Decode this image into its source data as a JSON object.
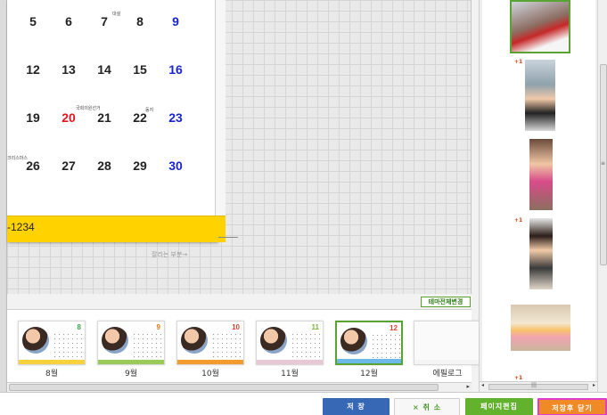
{
  "calendar": {
    "rows": [
      {
        "days": [
          {
            "n": "5",
            "c": ""
          },
          {
            "n": "6",
            "c": ""
          },
          {
            "n": "7",
            "c": ""
          },
          {
            "n": "8",
            "c": ""
          },
          {
            "n": "9",
            "c": "blue"
          }
        ]
      },
      {
        "days": [
          {
            "n": "12",
            "c": ""
          },
          {
            "n": "13",
            "c": ""
          },
          {
            "n": "14",
            "c": ""
          },
          {
            "n": "15",
            "c": ""
          },
          {
            "n": "16",
            "c": "blue"
          }
        ]
      },
      {
        "days": [
          {
            "n": "19",
            "c": ""
          },
          {
            "n": "20",
            "c": "red"
          },
          {
            "n": "21",
            "c": ""
          },
          {
            "n": "22",
            "c": ""
          },
          {
            "n": "23",
            "c": "blue"
          }
        ]
      },
      {
        "days": [
          {
            "n": "26",
            "c": ""
          },
          {
            "n": "27",
            "c": ""
          },
          {
            "n": "28",
            "c": ""
          },
          {
            "n": "29",
            "c": ""
          },
          {
            "n": "30",
            "c": "blue"
          }
        ]
      }
    ],
    "notes": {
      "row1_day3": "대설",
      "row3_day2": "국회의원선거",
      "row3_day4": "동지",
      "row4_day1": "크리스마스"
    },
    "phone": "-1234",
    "cut_label": "잘리는 부분→"
  },
  "theme_button": "테마전체변경",
  "thumbnails": [
    {
      "label": "8월",
      "month": "8",
      "accent": "#3aa84a",
      "bar": "#f6d33c"
    },
    {
      "label": "9월",
      "month": "9",
      "accent": "#e07a1a",
      "bar": "#9acb59"
    },
    {
      "label": "10월",
      "month": "10",
      "accent": "#e0402b",
      "bar": "#f39c2d"
    },
    {
      "label": "11월",
      "month": "11",
      "accent": "#7bb33a",
      "bar": "#e8c7d7"
    },
    {
      "label": "12월",
      "month": "12",
      "accent": "#e0402b",
      "bar": "#6cb9e8",
      "selected": true
    },
    {
      "label": "에필로그",
      "month": "",
      "accent": "#cccccc",
      "bar": "#f4f4f4"
    }
  ],
  "photos": [
    {
      "badge": "",
      "selected": true
    },
    {
      "badge": "+1",
      "selected": false
    },
    {
      "badge": "",
      "selected": false
    },
    {
      "badge": "+1",
      "selected": false
    },
    {
      "badge": "",
      "selected": false
    },
    {
      "badge": "+1",
      "selected": false
    }
  ],
  "toolbar": {
    "save": "저 장",
    "cancel": "× 취 소",
    "edit": "페이지편집",
    "save_close": "저장후 닫기"
  },
  "colors": {
    "save": "#3768b5",
    "edit": "#63b22e",
    "save_close": "#f08a27",
    "band": "#ffd200",
    "selection": "#59a332"
  }
}
